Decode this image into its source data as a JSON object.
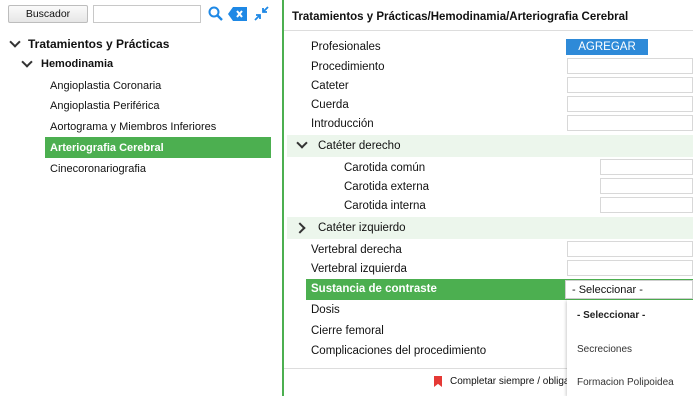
{
  "sidebar": {
    "search_button": "Buscador",
    "search_value": "",
    "tree": {
      "root": "Tratamientos y Prácticas",
      "group": "Hemodinamia",
      "items": [
        "Angioplastia Coronaria",
        "Angioplastia Periférica",
        "Aortograma y Miembros Inferiores",
        "Arteriografia Cerebral",
        "Cinecoronariografia"
      ],
      "selected_index": 3
    }
  },
  "main": {
    "breadcrumb": "Tratamientos y Prácticas/Hemodinamia/Arteriografia Cerebral",
    "fields": {
      "profesionales": "Profesionales",
      "agregar": "AGREGAR",
      "procedimiento": "Procedimiento",
      "cateter": "Cateter",
      "cuerda": "Cuerda",
      "introduccion": "Introducción",
      "group_derecho": "Catéter derecho",
      "carotida_comun": "Carotida común",
      "carotida_externa": "Carotida externa",
      "carotida_interna": "Carotida interna",
      "group_izquierdo": "Catéter izquierdo",
      "vertebral_derecha": "Vertebral derecha",
      "vertebral_izquierda": "Vertebral izquierda",
      "sustancia": "Sustancia de contraste",
      "dosis": "Dosis",
      "cierre": "Cierre femoral",
      "complicaciones": "Complicaciones del procedimiento"
    },
    "select": {
      "value": "- Seleccionar -",
      "options": [
        "- Seleccionar -",
        "Secreciones",
        "Formacion Polipoidea"
      ]
    },
    "footer_text": "Completar siempre / obligat"
  }
}
